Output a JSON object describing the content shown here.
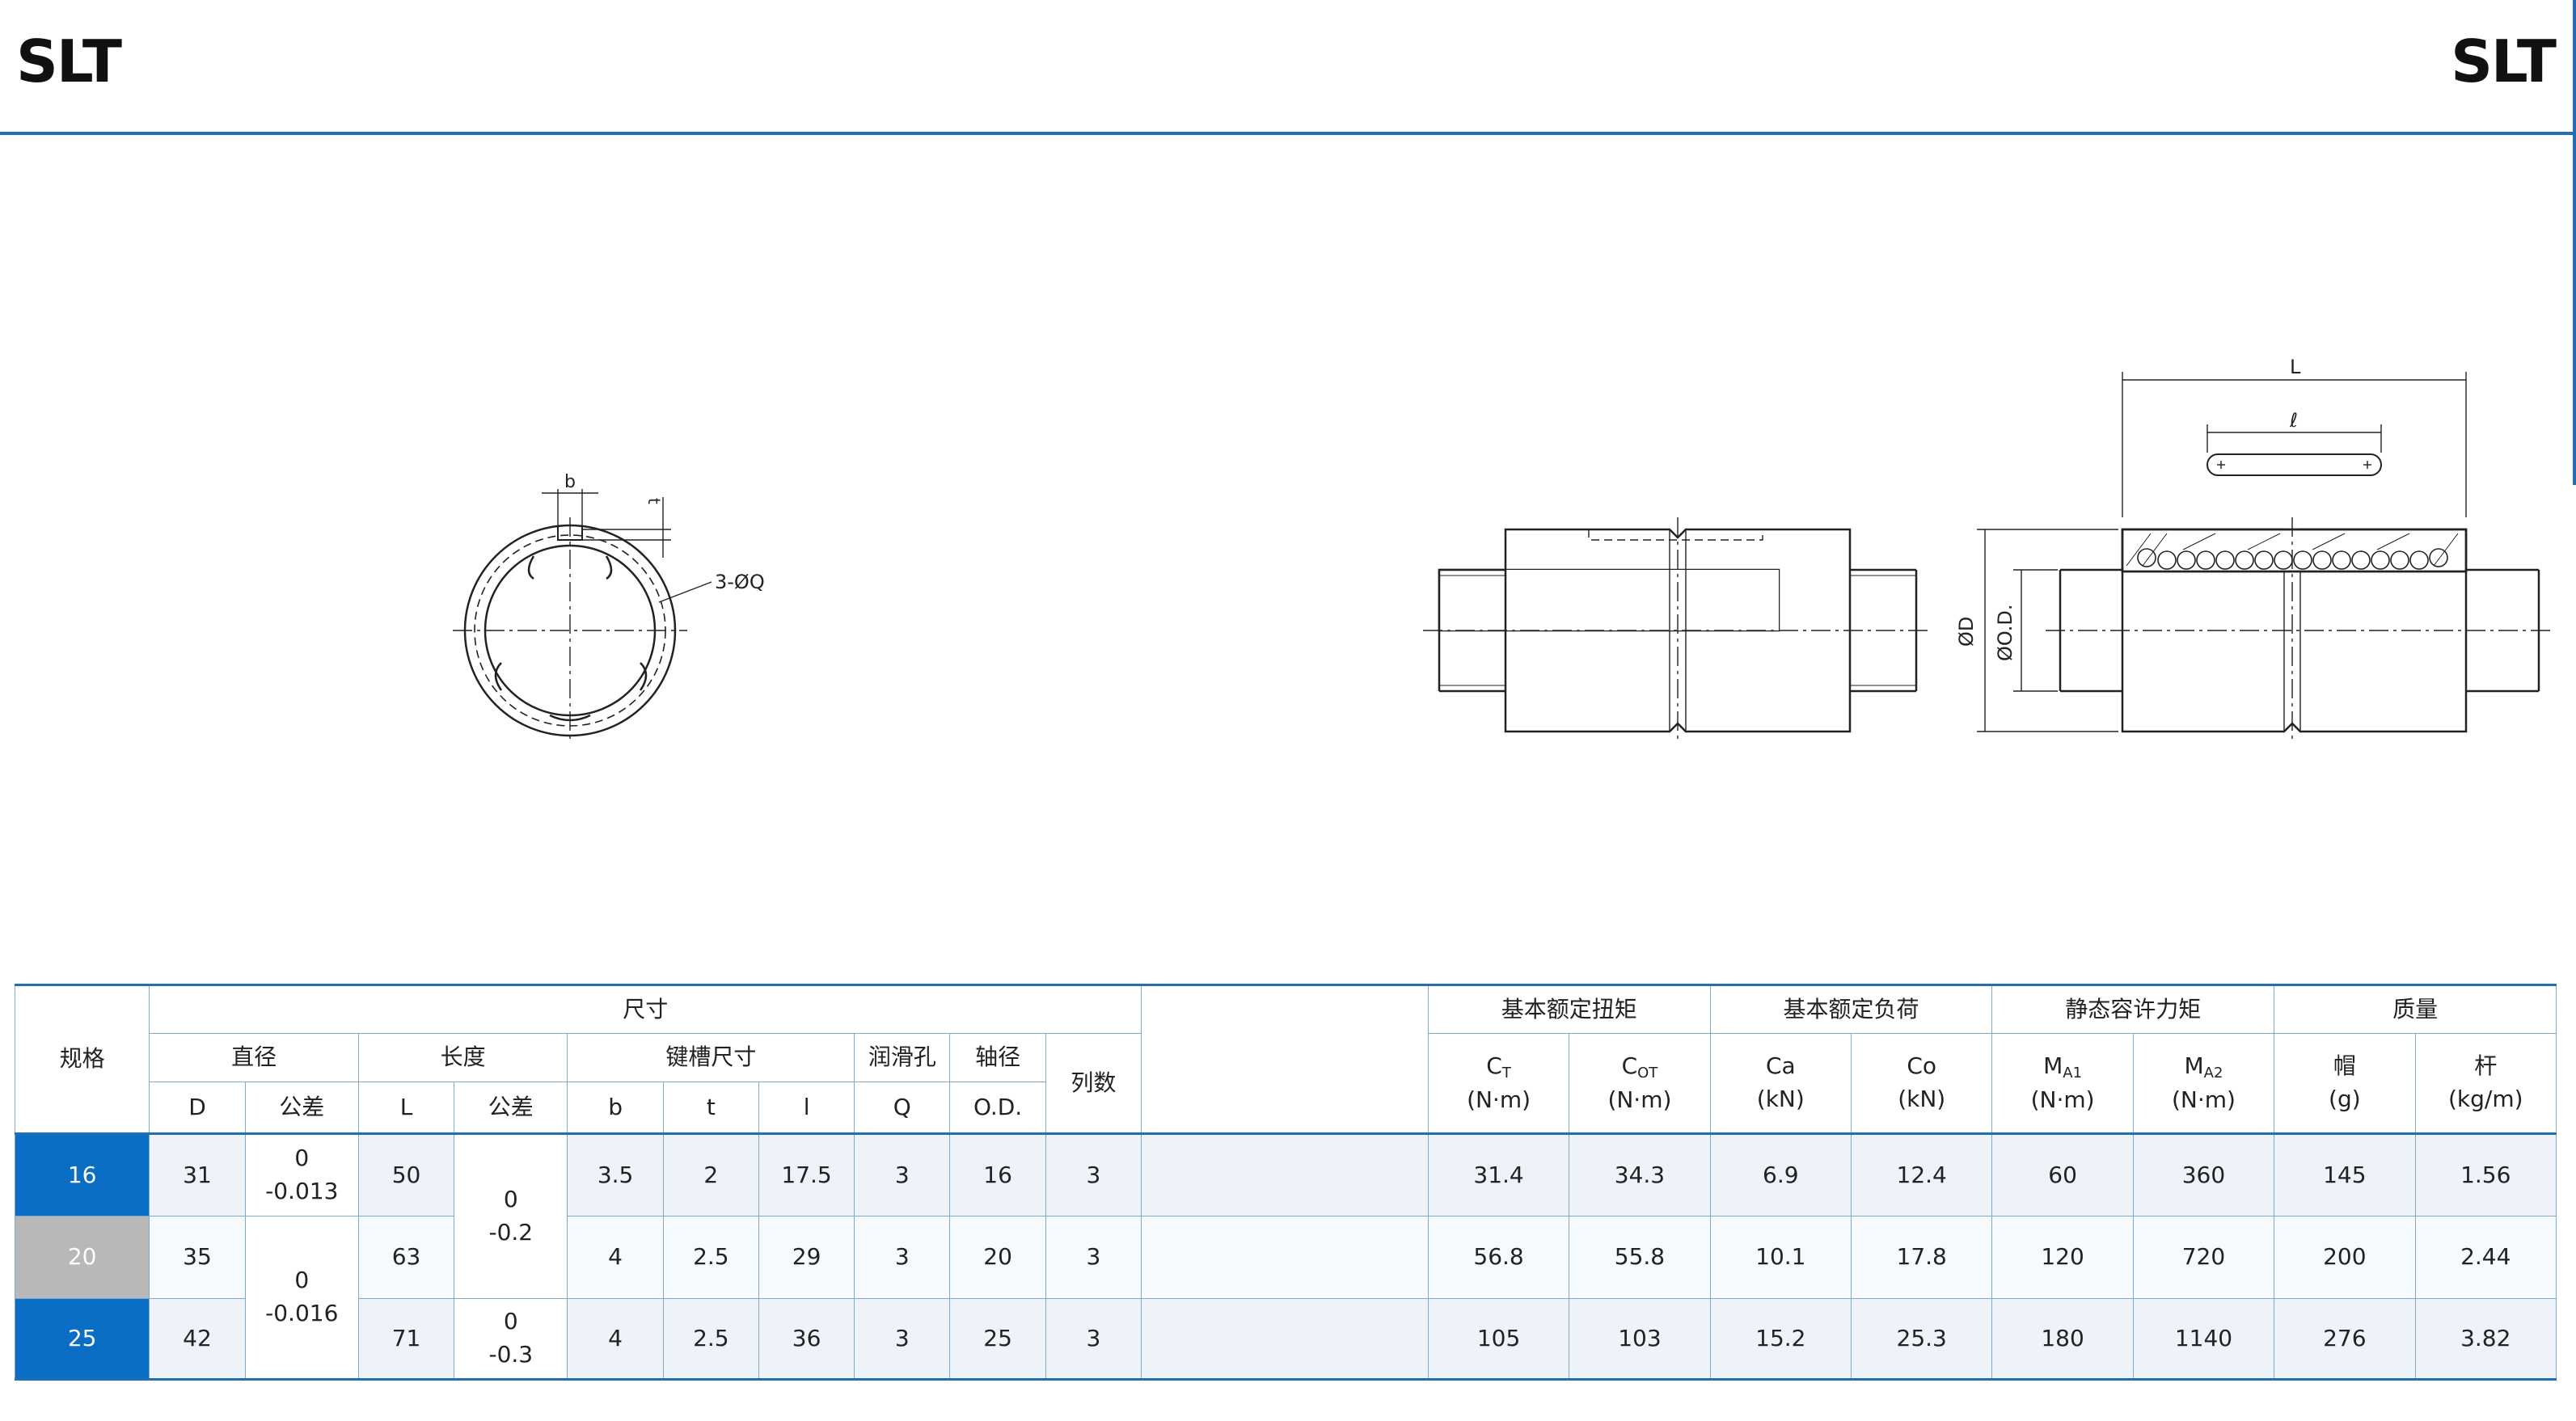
{
  "header": {
    "title_left": "SLT",
    "title_right": "SLT"
  },
  "drawing": {
    "section_labels": {
      "b": "b",
      "t": "t",
      "q": "3-ØQ"
    },
    "side_labels": {
      "L": "L",
      "l": "ℓ",
      "D": "ØD",
      "OD": "ØO.D."
    }
  },
  "table": {
    "head": {
      "spec": "规格",
      "dims": "尺寸",
      "diameter": "直径",
      "length": "长度",
      "keyway": "键槽尺寸",
      "lube": "润滑孔",
      "shaft": "轴径",
      "rows": "列数",
      "torque": "基本额定扭矩",
      "load": "基本额定负荷",
      "moment": "静态容许力矩",
      "mass": "质量",
      "D": "D",
      "tol": "公差",
      "L": "L",
      "tol2": "公差",
      "b": "b",
      "t": "t",
      "l": "l",
      "Q": "Q",
      "OD": "O.D.",
      "CT": "C",
      "CT_sub": "T",
      "CT_unit": "(N·m)",
      "COT": "C",
      "COT_sub": "OT",
      "COT_unit": "(N·m)",
      "Ca": "Ca",
      "Ca_unit": "(kN)",
      "Co": "Co",
      "Co_unit": "(kN)",
      "MA1": "M",
      "MA1_sub": "A1",
      "MA1_unit": "(N·m)",
      "MA2": "M",
      "MA2_sub": "A2",
      "MA2_unit": "(N·m)",
      "cap": "帽",
      "cap_unit": "(g)",
      "rod": "杆",
      "rod_unit": "(kg/m)"
    },
    "rows": [
      {
        "spec": "16",
        "D": "31",
        "D_tol_a": "0",
        "D_tol_b": "-0.013",
        "L": "50",
        "b": "3.5",
        "t": "2",
        "l": "17.5",
        "Q": "3",
        "OD": "16",
        "rows": "3",
        "CT": "31.4",
        "COT": "34.3",
        "Ca": "6.9",
        "Co": "12.4",
        "MA1": "60",
        "MA2": "360",
        "cap": "145",
        "rod": "1.56"
      },
      {
        "spec": "20",
        "D": "35",
        "L": "63",
        "b": "4",
        "t": "2.5",
        "l": "29",
        "Q": "3",
        "OD": "20",
        "rows": "3",
        "CT": "56.8",
        "COT": "55.8",
        "Ca": "10.1",
        "Co": "17.8",
        "MA1": "120",
        "MA2": "720",
        "cap": "200",
        "rod": "2.44"
      },
      {
        "spec": "25",
        "D": "42",
        "L": "71",
        "b": "4",
        "t": "2.5",
        "l": "36",
        "Q": "3",
        "OD": "25",
        "rows": "3",
        "CT": "105",
        "COT": "103",
        "Ca": "15.2",
        "Co": "25.3",
        "MA1": "180",
        "MA2": "1140",
        "cap": "276",
        "rod": "3.82"
      }
    ],
    "merged": {
      "D_tol_ab_a": "0",
      "D_tol_ab_b": "-0.016",
      "L_tol_top_a": "0",
      "L_tol_top_b": "-0.2",
      "L_tol_bot_a": "0",
      "L_tol_bot_b": "-0.3"
    }
  }
}
